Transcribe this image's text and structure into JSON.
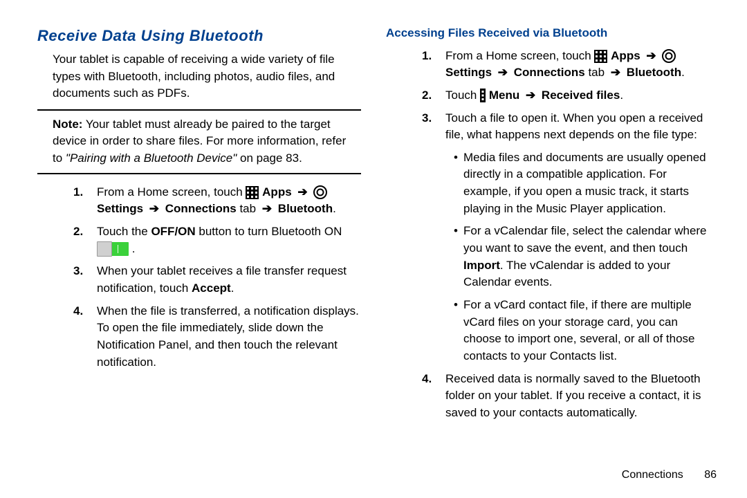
{
  "left": {
    "title": "Receive Data Using Bluetooth",
    "intro": "Your tablet is capable of receiving a wide variety of file types with Bluetooth, including photos, audio files, and documents such as PDFs.",
    "note_lead": "Note:",
    "note_body": " Your tablet must already be paired to the target device in order to share files. For more information, refer to ",
    "note_ref": "\"Pairing with a Bluetooth Device\"",
    "note_ref_suffix": " on page 83.",
    "step1_a": "From a Home screen, touch ",
    "step1_apps": " Apps ",
    "step1_settings": " Settings ",
    "step1_conn": " Connections",
    "step1_tab": " tab ",
    "step1_bt": " Bluetooth",
    "step2_a": "Touch the ",
    "step2_off_on": "OFF/ON",
    "step2_b": " button to turn Bluetooth ON ",
    "step3": "When your tablet receives a file transfer request notification, touch ",
    "step3_accept": "Accept",
    "step4": "When the file is transferred, a notification displays. To open the file immediately, slide down the Notification Panel, and then touch the relevant notification."
  },
  "right": {
    "title": "Accessing Files Received via Bluetooth",
    "step1_a": "From a Home screen, touch ",
    "step1_apps": " Apps ",
    "step1_settings": " Settings ",
    "step1_conn": " Connections",
    "step1_tab": " tab ",
    "step1_bt": " Bluetooth",
    "step2_a": "Touch ",
    "step2_menu": " Menu ",
    "step2_files": " Received files",
    "step3": "Touch a file to open it. When you open a received file, what happens next depends on the file type:",
    "bullet1": "Media files and documents are usually opened directly in a compatible application. For example, if you open a music track, it starts playing in the Music Player application.",
    "bullet2_a": "For a vCalendar file, select the calendar where you want to save the event, and then touch ",
    "bullet2_import": "Import",
    "bullet2_b": ". The vCalendar is added to your Calendar events.",
    "bullet3": "For a vCard contact file, if there are multiple vCard files on your storage card, you can choose to import one, several, or all of those contacts to your Contacts list.",
    "step4": "Received data is normally saved to the Bluetooth folder on your tablet. If you receive a contact, it is saved to your contacts automatically."
  },
  "footer": {
    "section": "Connections",
    "page": "86"
  }
}
